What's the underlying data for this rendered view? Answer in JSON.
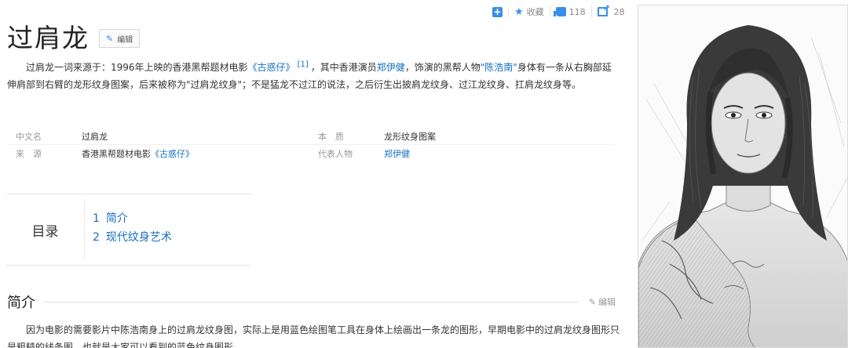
{
  "toolbar": {
    "favorite_label": "收藏",
    "like_count": "118",
    "share_count": "28"
  },
  "page": {
    "title": "过肩龙",
    "edit_label": "编辑"
  },
  "intro": {
    "p1_a": "过肩龙一词来源于：1996年上映的香港黑帮题材电影",
    "p1_film_link": "《古惑仔》",
    "p1_ref": "[1]",
    "p1_b": "，其中香港演员",
    "p1_actor_link": "郑伊健",
    "p1_c": "，饰演的黑帮人物",
    "p1_role_link": "\"陈浩南\"",
    "p1_d": "身体有一条从右胸部延伸肩部到右臂的龙形纹身图案，后来被称为\"过肩龙纹身\"；不是猛龙不过江的说法，之后衍生出披肩龙纹身、过江龙纹身、扛肩龙纹身等。"
  },
  "infobox": {
    "row1": {
      "name1": "中文名",
      "value1": "过肩龙",
      "name2": "本　质",
      "value2": "龙形纹身图案"
    },
    "row2": {
      "name1": "来　源",
      "value1_prefix": "香港黑帮题材电影",
      "value1_link": "《古惑仔》",
      "name2": "代表人物",
      "value2_link": "郑伊健"
    }
  },
  "toc": {
    "title": "目录",
    "items": [
      {
        "num": "1",
        "label": "简介"
      },
      {
        "num": "2",
        "label": "现代纹身艺术"
      }
    ]
  },
  "section": {
    "title": "简介",
    "edit_label": "编辑",
    "body": "因为电影的需要影片中陈浩南身上的过肩龙纹身图，实际上是用蓝色绘图笔工具在身体上绘画出一条龙的图形，早期电影中的过肩龙纹身图形只是粗糙的线条图，也就是大家可以看到的蓝色纹身图形。"
  },
  "icons": {
    "add": "plus-square-icon",
    "favorite": "star-icon",
    "like": "thumbs-up-icon",
    "share": "share-icon",
    "edit": "pencil-icon"
  },
  "colors": {
    "link": "#136ec2",
    "accent": "#3a8ee6"
  }
}
